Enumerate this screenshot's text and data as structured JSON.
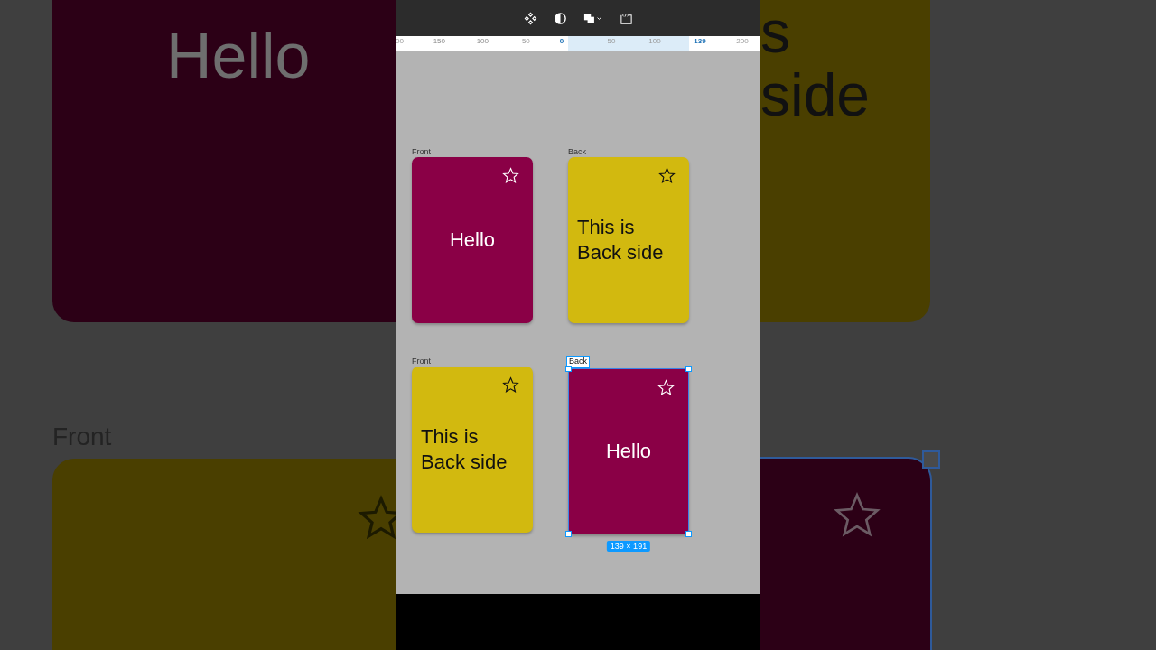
{
  "backdrop": {
    "left": {
      "card_text": "Hello",
      "label": "Front"
    },
    "right": {
      "card_texts": [
        "s",
        "side"
      ]
    }
  },
  "toolbar": {
    "icons": [
      {
        "kind": "components"
      },
      {
        "kind": "contrast"
      },
      {
        "kind": "boolean"
      },
      {
        "kind": "code"
      }
    ]
  },
  "ruler": {
    "ticks": [
      {
        "label": "00",
        "kind": "faint"
      },
      {
        "label": "-150",
        "kind": "normal"
      },
      {
        "label": "-100",
        "kind": "normal"
      },
      {
        "label": "-50",
        "kind": "faint"
      },
      {
        "label": "0",
        "kind": "marker"
      },
      {
        "label": "50",
        "kind": "faint"
      },
      {
        "label": "100",
        "kind": "faint"
      },
      {
        "label": "139",
        "kind": "marker"
      },
      {
        "label": "200",
        "kind": "faint"
      }
    ]
  },
  "cards": [
    {
      "label": "Front",
      "text": "Hello",
      "kind": "dark",
      "color": "#8a0046",
      "selected": false
    },
    {
      "label": "Back",
      "text": "This is Back side",
      "kind": "light",
      "color": "#d2b90f",
      "selected": false
    },
    {
      "label": "Front",
      "text": "This is Back side",
      "kind": "light",
      "color": "#d2b90f",
      "selected": false
    },
    {
      "label": "Back",
      "text": "Hello",
      "kind": "dark",
      "color": "#8a0046",
      "selected": true,
      "size": "139 × 191"
    }
  ]
}
